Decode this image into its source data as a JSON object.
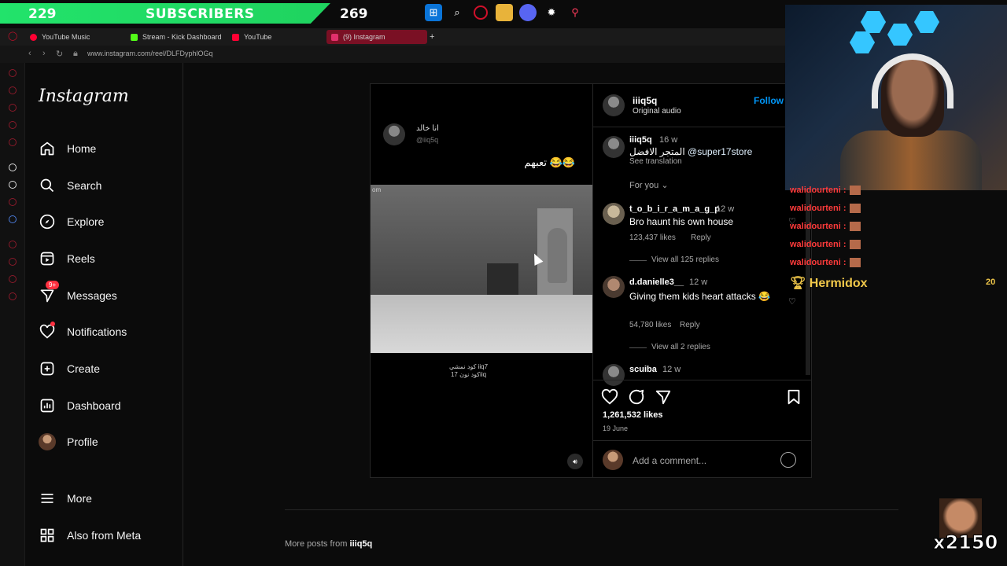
{
  "overlay": {
    "subscriber_count": "229",
    "subscriber_label": "SUBSCRIBERS",
    "subscriber_goal": "269"
  },
  "browser": {
    "tabs": [
      {
        "label": "YouTube Music",
        "color": "#ff0033"
      },
      {
        "label": "Stream - Kick Dashboard",
        "color": "#53fc18"
      },
      {
        "label": "YouTube",
        "color": "#ff0033"
      },
      {
        "label": "(9) Instagram",
        "color": "#e1306c"
      }
    ],
    "new_tab": "+",
    "url": "www.instagram.com/reel/DLFDyphlOGq"
  },
  "instagram": {
    "logo": "Instagram",
    "nav": [
      {
        "label": "Home",
        "icon": "home-icon"
      },
      {
        "label": "Search",
        "icon": "search-icon"
      },
      {
        "label": "Explore",
        "icon": "compass-icon"
      },
      {
        "label": "Reels",
        "icon": "reels-icon"
      },
      {
        "label": "Messages",
        "icon": "messenger-icon",
        "badge": "9+"
      },
      {
        "label": "Notifications",
        "icon": "heart-icon"
      },
      {
        "label": "Create",
        "icon": "plus-square-icon"
      },
      {
        "label": "Dashboard",
        "icon": "dashboard-icon"
      },
      {
        "label": "Profile",
        "icon": "avatar"
      },
      {
        "label": "More",
        "icon": "menu-icon"
      },
      {
        "label": "Also from Meta",
        "icon": "meta-icon"
      }
    ]
  },
  "post": {
    "media": {
      "name": "انا خالد",
      "handle": "@iiq5q",
      "caption": "تعبهم 😂😂",
      "footer_line1": "كود نمشي iiq7",
      "footer_line2": "كود نون 17iiq",
      "watermark": "om"
    },
    "author": "iiiq5q",
    "audio": "Original audio",
    "follow": "Follow",
    "caption": {
      "user": "iiiq5q",
      "time": "16 w",
      "text": "المتجر الافضل",
      "mention": "@super17store",
      "translate": "See translation"
    },
    "filter": "For you",
    "comments": [
      {
        "user": "t_o_b_i_r_a_m_a_g_p",
        "time": "12 w",
        "text": "Bro haunt his own house",
        "likes": "123,437 likes",
        "reply": "Reply",
        "view_replies": "View all 125 replies"
      },
      {
        "user": "d.danielle3__",
        "time": "12 w",
        "text": "Giving them kids heart attacks 😂",
        "likes": "54,780 likes",
        "reply": "Reply",
        "view_replies": "View all 2 replies"
      },
      {
        "user": "scuiba",
        "time": "12 w"
      }
    ],
    "likes": "1,261,532 likes",
    "date": "19 June",
    "add_comment_placeholder": "Add a comment..."
  },
  "more_posts": {
    "prefix": "More posts from",
    "user": "iiiq5q"
  },
  "stream": {
    "chat": [
      "walidourteni :",
      "walidourteni :",
      "walidourteni :",
      "walidourteni :",
      "walidourteni :"
    ],
    "top_donor": "Hermidox",
    "top_count": "20",
    "combo": "x2150"
  }
}
